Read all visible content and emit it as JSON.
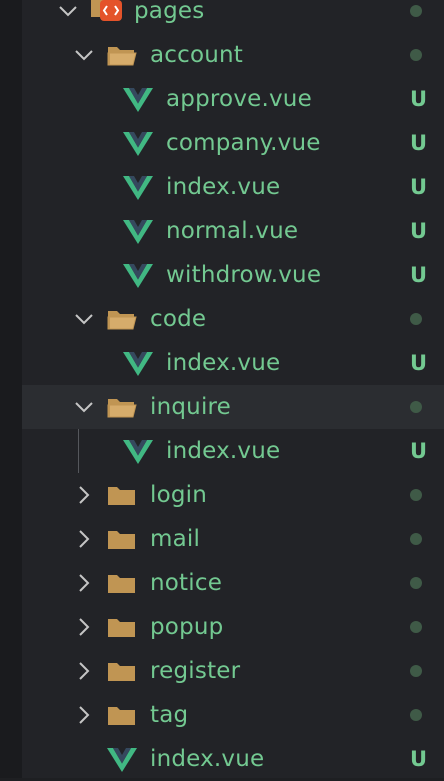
{
  "tree": {
    "pages": {
      "label": "pages"
    },
    "account": {
      "label": "account"
    },
    "account_files": [
      {
        "label": "approve.vue",
        "status": "U"
      },
      {
        "label": "company.vue",
        "status": "U"
      },
      {
        "label": "index.vue",
        "status": "U"
      },
      {
        "label": "normal.vue",
        "status": "U"
      },
      {
        "label": "withdrow.vue",
        "status": "U"
      }
    ],
    "code": {
      "label": "code"
    },
    "code_files": [
      {
        "label": "index.vue",
        "status": "U"
      }
    ],
    "inquire": {
      "label": "inquire"
    },
    "inquire_files": [
      {
        "label": "index.vue",
        "status": "U"
      }
    ],
    "collapsed_folders": [
      {
        "label": "login"
      },
      {
        "label": "mail"
      },
      {
        "label": "notice"
      },
      {
        "label": "popup"
      },
      {
        "label": "register"
      },
      {
        "label": "tag"
      }
    ],
    "root_file": {
      "label": "index.vue",
      "status": "U"
    }
  },
  "colors": {
    "label": "#73c991",
    "vue_dark": "#35495e",
    "vue_green": "#41b883",
    "folder": "#c09553",
    "pages_badge": "#e4532a",
    "dot": "#3f5a47",
    "selected_row": "#2b2d31"
  },
  "icons": {
    "expanded": "chevron-down-icon",
    "collapsed": "chevron-right-icon",
    "folder_open": "folder-open-icon",
    "folder_closed": "folder-icon",
    "vue_file": "vue-file-icon",
    "pages_folder": "pages-folder-icon"
  }
}
